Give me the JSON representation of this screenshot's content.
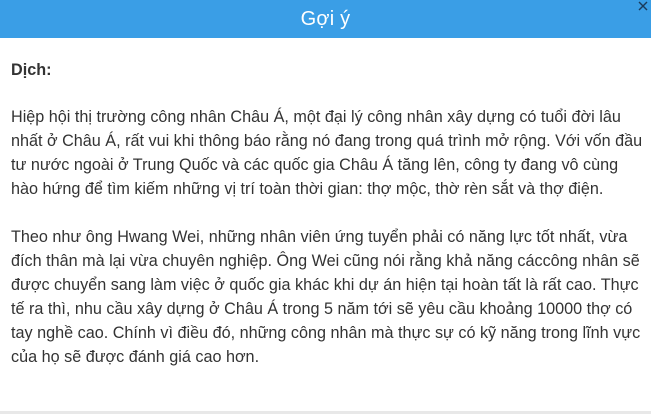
{
  "header": {
    "title": "Gợi ý",
    "close_icon": "close-icon"
  },
  "content": {
    "label": "Dịch:",
    "paragraphs": [
      "Hiệp hội thị trường công nhân Châu Á, một đại lý công nhân xây dựng có tuổi đời lâu nhất ở Châu Á, rất vui khi thông báo rằng nó đang trong quá trình mở rộng. Với vốn đầu tư nước ngoài ở Trung Quốc và các quốc gia Châu Á tăng lên, công ty đang vô cùng hào hứng để tìm kiếm những vị trí toàn thời gian: thợ mộc, thờ rèn sắt và thợ điện.",
      "Theo như ông Hwang Wei, những nhân viên ứng tuyển phải có năng lực tốt nhất, vừa đích thân mà lại vừa chuyên nghiệp. Ông Wei cũng nói rằng khả năng cáccông nhân sẽ được chuyển sang làm việc ở quốc gia khác khi dự án hiện tại hoàn tất là rất cao. Thực tế ra thì, nhu cầu xây dựng ở Châu Á trong 5 năm tới sẽ yêu cầu khoảng 10000 thợ có tay nghề cao. Chính vì điều đó, những công nhân mà thực sự có kỹ năng trong lĩnh vực của họ sẽ được đánh giá cao hơn."
    ]
  },
  "colors": {
    "header_bg": "#3a9ee6",
    "header_text": "#ffffff",
    "body_text": "#333333"
  }
}
